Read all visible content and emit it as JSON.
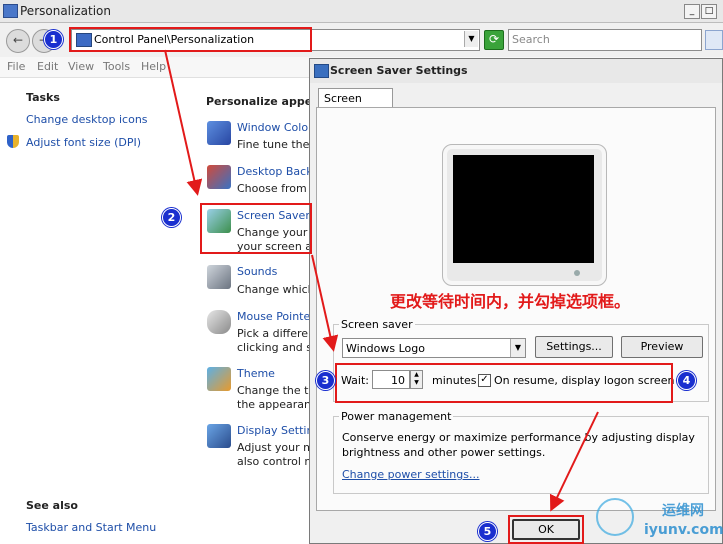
{
  "window": {
    "title": "Personalization"
  },
  "address": {
    "path": "Control Panel\\Personalization",
    "search_placeholder": "Search"
  },
  "menu": [
    "File",
    "Edit",
    "View",
    "Tools",
    "Help"
  ],
  "left_pane": {
    "tasks_heading": "Tasks",
    "tasks": [
      "Change desktop icons",
      "Adjust font size (DPI)"
    ],
    "see_also_heading": "See also",
    "see_also": [
      "Taskbar and Start Menu"
    ]
  },
  "main": {
    "heading": "Personalize appeara",
    "items": [
      {
        "title": "Window Color ar",
        "desc": [
          "Fine tune the co"
        ]
      },
      {
        "title": "Desktop Backgro",
        "desc": [
          "Choose from av"
        ]
      },
      {
        "title": "Screen Saver",
        "desc": [
          "Change your sc",
          "your screen and"
        ]
      },
      {
        "title": "Sounds",
        "desc": [
          "Change which so"
        ]
      },
      {
        "title": "Mouse Pointers",
        "desc": [
          "Pick a different r",
          "clicking and sele"
        ]
      },
      {
        "title": "Theme",
        "desc": [
          "Change the ther",
          "the appearance"
        ]
      },
      {
        "title": "Display Settings",
        "desc": [
          "Adjust your mor",
          "also control mon"
        ]
      }
    ]
  },
  "dialog": {
    "title": "Screen Saver Settings",
    "tab": "Screen Saver",
    "annotation_text": "更改等待时间内，并勾掉选项框。",
    "screen_saver_group": "Screen saver",
    "selected": "Windows Logo",
    "settings_button": "Settings...",
    "preview_button": "Preview",
    "wait_label": "Wait:",
    "wait_value": "10",
    "minutes_label": "minutes",
    "resume_label": "On resume, display logon screen",
    "resume_checked": true,
    "power_group": "Power management",
    "power_text": [
      "Conserve energy or maximize performance by adjusting display",
      "brightness and other power settings."
    ],
    "power_link": "Change power settings...",
    "ok_button": "OK"
  },
  "badges": [
    "1",
    "2",
    "3",
    "4",
    "5"
  ],
  "watermark": {
    "cn": "运维网",
    "url": "iyunv.com"
  },
  "colors": {
    "annotation_red": "#e21a1a",
    "badge_blue": "#1a2fcf",
    "link_blue": "#1e4ea8"
  }
}
